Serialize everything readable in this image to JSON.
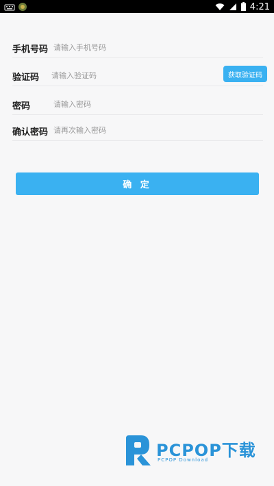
{
  "status_bar": {
    "time": "4:21",
    "icons": [
      "keyboard-icon",
      "app-notification-icon",
      "wifi-icon",
      "signal-icon",
      "battery-icon"
    ]
  },
  "form": {
    "phone": {
      "label": "手机号码",
      "placeholder": "请输入手机号码"
    },
    "code": {
      "label": "验证码",
      "placeholder": "请输入验证码",
      "button": "获取验证码"
    },
    "password": {
      "label": "密码",
      "placeholder": "请输入密码"
    },
    "confirm_password": {
      "label": "确认密码",
      "placeholder": "请再次输入密码"
    }
  },
  "confirm_button": "确 定",
  "watermark": {
    "title": "PCPOP下载",
    "subtitle": "PCPOP Download"
  },
  "colors": {
    "accent": "#3ab1f1",
    "background": "#f7f7f8",
    "watermark": "#2a93d8"
  }
}
